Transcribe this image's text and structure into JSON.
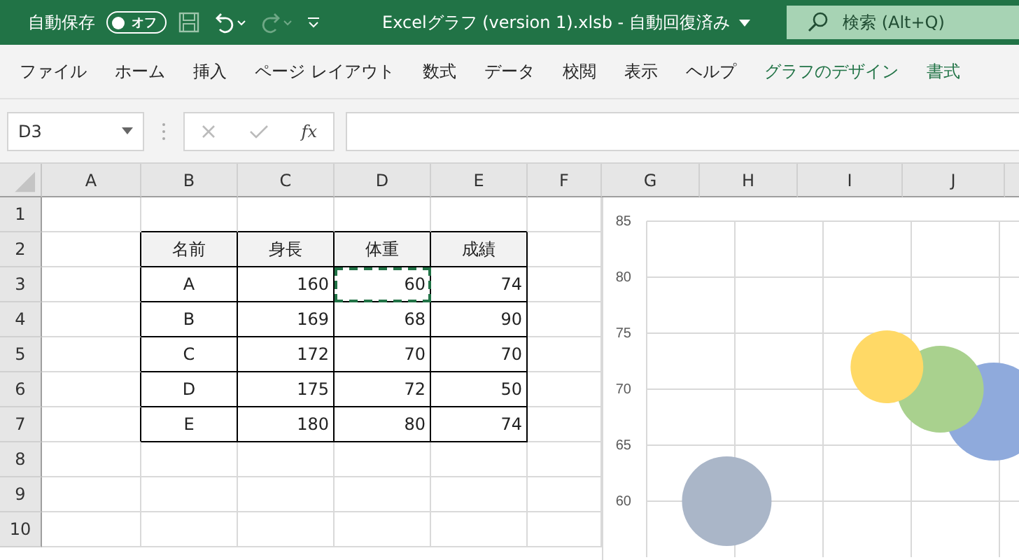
{
  "title_bar": {
    "autosave_label": "自動保存",
    "autosave_toggle": {
      "label": "オフ",
      "on": false
    },
    "redo_disabled": true,
    "title": "Excelグラフ (version 1).xlsb  -  自動回復済み",
    "search": {
      "placeholder": "検索 (Alt+Q)"
    }
  },
  "ribbon_tabs": [
    {
      "label": "ファイル",
      "kind": "normal"
    },
    {
      "label": "ホーム",
      "kind": "normal"
    },
    {
      "label": "挿入",
      "kind": "normal"
    },
    {
      "label": "ページ レイアウト",
      "kind": "normal"
    },
    {
      "label": "数式",
      "kind": "normal"
    },
    {
      "label": "データ",
      "kind": "normal"
    },
    {
      "label": "校閲",
      "kind": "normal"
    },
    {
      "label": "表示",
      "kind": "normal"
    },
    {
      "label": "ヘルプ",
      "kind": "normal"
    },
    {
      "label": "グラフのデザイン",
      "kind": "contextual"
    },
    {
      "label": "書式",
      "kind": "contextual"
    }
  ],
  "formula_bar": {
    "name_box": "D3",
    "fx": "fx"
  },
  "sheet": {
    "columns": [
      "A",
      "B",
      "C",
      "D",
      "E",
      "F",
      "G",
      "H",
      "I",
      "J"
    ],
    "rows": [
      "1",
      "2",
      "3",
      "4",
      "5",
      "6",
      "7",
      "8",
      "9",
      "10"
    ],
    "table": {
      "header": [
        "名前",
        "身長",
        "体重",
        "成績"
      ],
      "rows": [
        {
          "cells": [
            {
              "text": "A",
              "marquee": false
            },
            {
              "text": "160",
              "marquee": false
            },
            {
              "text": "60",
              "marquee": true
            },
            {
              "text": "74",
              "marquee": false
            }
          ]
        },
        {
          "cells": [
            {
              "text": "B",
              "marquee": false
            },
            {
              "text": "169",
              "marquee": false
            },
            {
              "text": "68",
              "marquee": false
            },
            {
              "text": "90",
              "marquee": false
            }
          ]
        },
        {
          "cells": [
            {
              "text": "C",
              "marquee": false
            },
            {
              "text": "172",
              "marquee": false
            },
            {
              "text": "70",
              "marquee": false
            },
            {
              "text": "70",
              "marquee": false
            }
          ]
        },
        {
          "cells": [
            {
              "text": "D",
              "marquee": false
            },
            {
              "text": "175",
              "marquee": false
            },
            {
              "text": "72",
              "marquee": false
            },
            {
              "text": "50",
              "marquee": false
            }
          ]
        },
        {
          "cells": [
            {
              "text": "E",
              "marquee": false
            },
            {
              "text": "180",
              "marquee": false
            },
            {
              "text": "80",
              "marquee": false
            },
            {
              "text": "74",
              "marquee": false
            }
          ]
        }
      ]
    }
  },
  "chart": {
    "chart_data": {
      "type": "scatter",
      "grid": true,
      "categories": [
        null,
        null,
        null,
        null,
        null,
        null,
        null
      ],
      "ylim": [
        55,
        85
      ],
      "yticks": [
        60,
        65,
        70,
        75,
        80,
        85
      ],
      "series": [
        {
          "color": "#aab6c8",
          "values": [
            null,
            60,
            null,
            null,
            null,
            null,
            null
          ]
        },
        {
          "color": "#ffd966",
          "values": [
            null,
            null,
            null,
            null,
            72,
            null,
            null
          ]
        },
        {
          "color": "#a9d18e",
          "values": [
            null,
            null,
            null,
            null,
            null,
            70,
            null
          ]
        },
        {
          "color": "#8faadc",
          "values": [
            null,
            null,
            null,
            null,
            null,
            null,
            68
          ]
        }
      ]
    }
  }
}
